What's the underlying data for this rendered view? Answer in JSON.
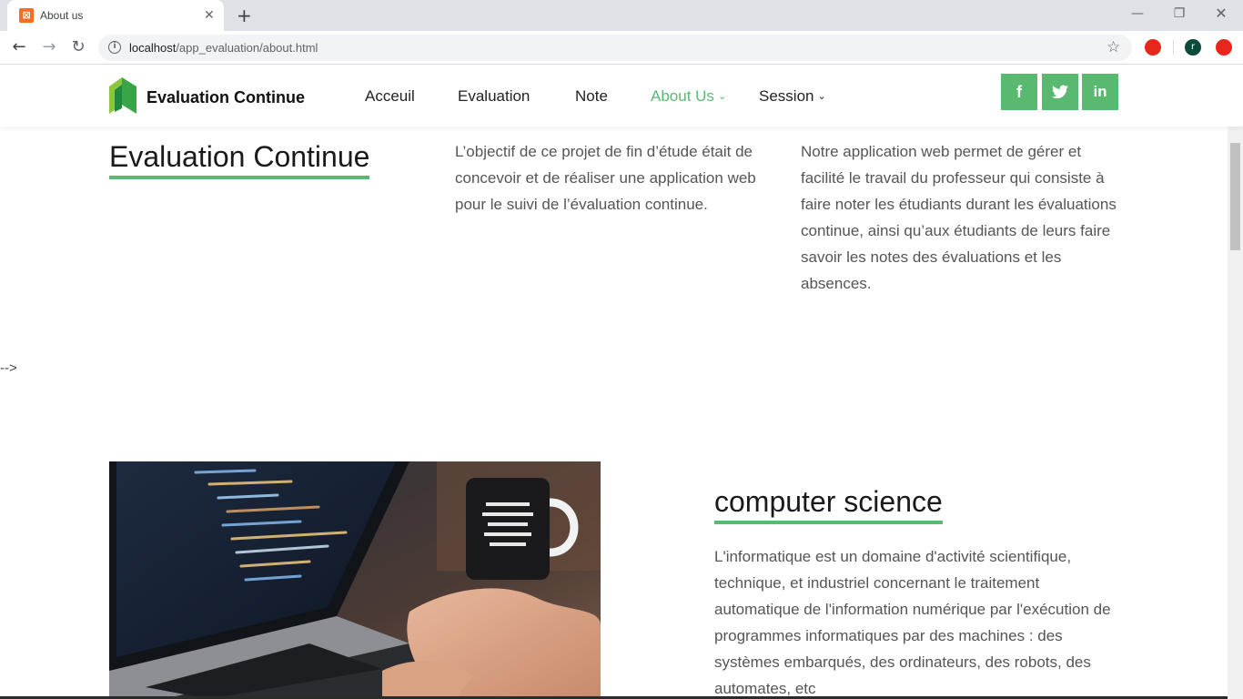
{
  "browser": {
    "tab_title": "About us",
    "url_host": "localhost",
    "url_path": "/app_evaluation/about.html",
    "profile_initial": "r"
  },
  "site": {
    "brand": "Evaluation Continue",
    "accent_color": "#5ab970",
    "menu": [
      {
        "label": "Acceuil",
        "active": false
      },
      {
        "label": "Evaluation",
        "active": false
      },
      {
        "label": "Note",
        "active": false
      },
      {
        "label": "About Us",
        "active": true,
        "dropdown": true
      },
      {
        "label": "Session",
        "active": false,
        "dropdown": true
      }
    ],
    "social": [
      {
        "icon": "facebook-icon",
        "glyph": "f"
      },
      {
        "icon": "twitter-icon",
        "glyph": "t"
      },
      {
        "icon": "linkedin-icon",
        "glyph": "in"
      }
    ]
  },
  "about": {
    "heading": "Evaluation Continue",
    "para1": "L’objectif de ce projet de fin d’étude était de concevoir et de réaliser une application web pour le suivi de l’évaluation continue.",
    "para2": "Notre application web permet de gérer et facilité le travail du professeur qui consiste à faire noter les étudiants durant les évaluations continue, ainsi qu’aux étudiants de leurs faire savoir les notes des évaluations et les absences."
  },
  "stray_text": "-->",
  "cs": {
    "heading": "computer science",
    "para": "L'informatique est un domaine d'activité scientifique, technique, et industriel concernant le traitement automatique de l'information numérique par l'exécution de programmes informatiques par des machines : des systèmes embarqués, des ordinateurs, des robots, des automates, etc"
  }
}
